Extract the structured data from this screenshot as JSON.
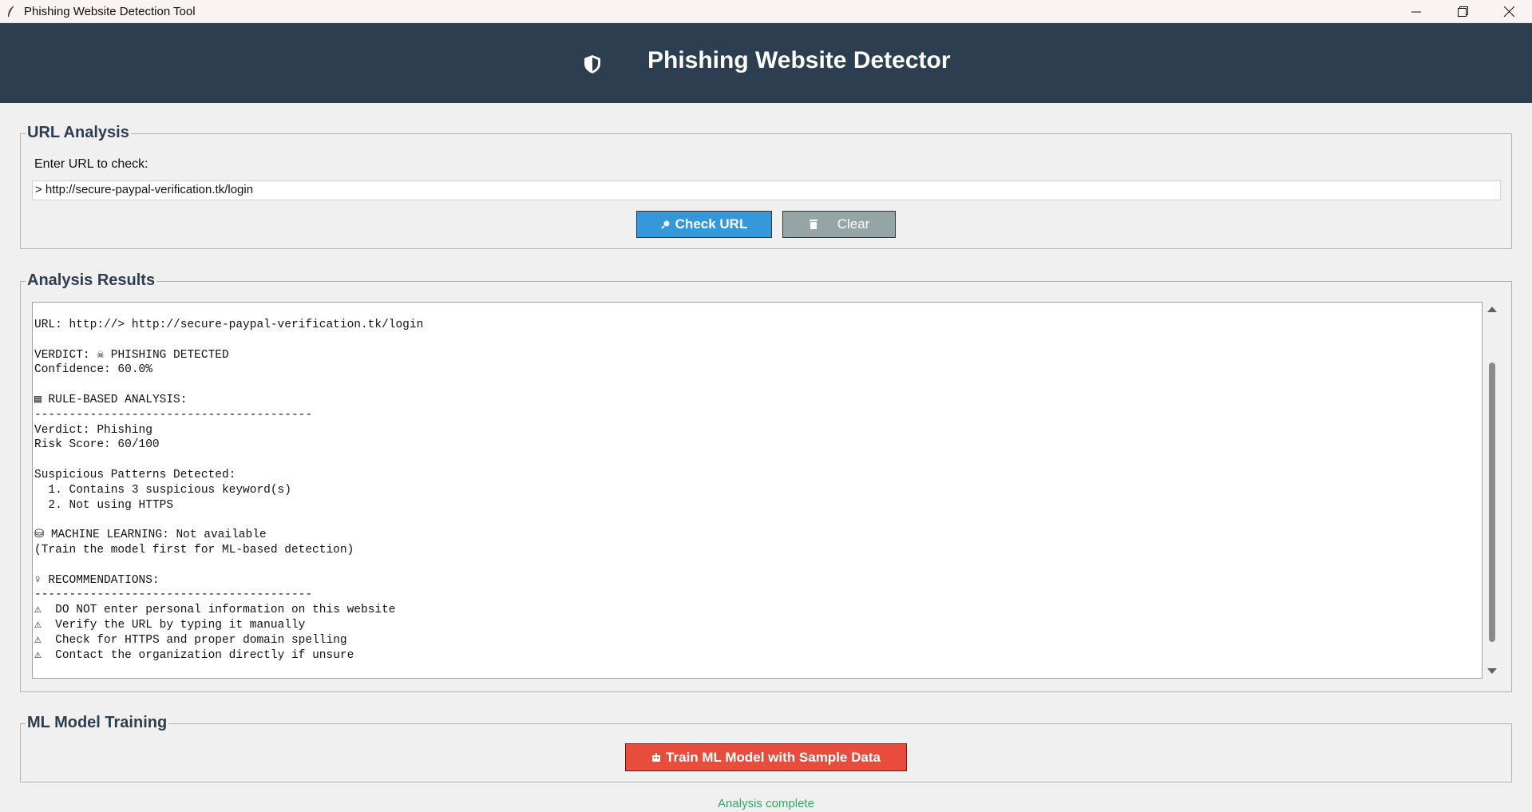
{
  "window": {
    "title": "Phishing Website Detection Tool"
  },
  "header": {
    "title": "Phishing Website Detector",
    "icon": "shield-icon"
  },
  "url_analysis": {
    "group_title": "URL Analysis",
    "label": "Enter URL to check:",
    "input_value": "> http://secure-paypal-verification.tk/login",
    "check_button": "Check URL",
    "clear_button": "Clear"
  },
  "results": {
    "group_title": "Analysis Results",
    "text": "URL: http://> http://secure-paypal-verification.tk/login\n\nVERDICT: ☠ PHISHING DETECTED\nConfidence: 60.0%\n\n▤ RULE-BASED ANALYSIS:\n----------------------------------------\nVerdict: Phishing\nRisk Score: 60/100\n\nSuspicious Patterns Detected:\n  1. Contains 3 suspicious keyword(s)\n  2. Not using HTTPS\n\n⛁ MACHINE LEARNING: Not available\n(Train the model first for ML-based detection)\n\n♀ RECOMMENDATIONS:\n----------------------------------------\n⚠  DO NOT enter personal information on this website\n⚠  Verify the URL by typing it manually\n⚠  Check for HTTPS and proper domain spelling\n⚠  Contact the organization directly if unsure"
  },
  "training": {
    "group_title": "ML Model Training",
    "train_button": "Train ML Model with Sample Data"
  },
  "status": {
    "text": "Analysis complete",
    "color": "#27ae60"
  },
  "colors": {
    "banner": "#2c3e50",
    "check_button": "#3498db",
    "clear_button": "#95a5a6",
    "train_button": "#e74c3c"
  }
}
